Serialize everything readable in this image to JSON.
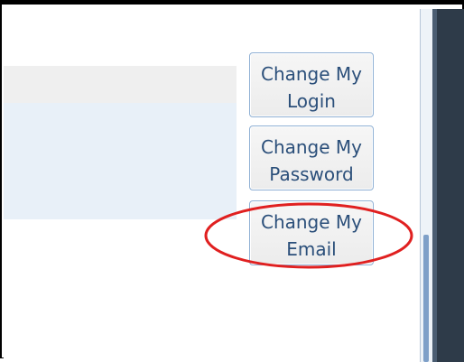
{
  "account_actions": {
    "change_login": {
      "line1": "Change My",
      "line2": "Login"
    },
    "change_password": {
      "line1": "Change My",
      "line2": "Password"
    },
    "change_email": {
      "line1": "Change My",
      "line2": "Email"
    }
  },
  "annotation": {
    "highlight_color": "#e02020",
    "target": "change_email"
  },
  "colors": {
    "button_border": "#8fb0d4",
    "button_text": "#2b4f7a",
    "panel_blue": "#e8f0f8",
    "strip_gray": "#efefef"
  }
}
